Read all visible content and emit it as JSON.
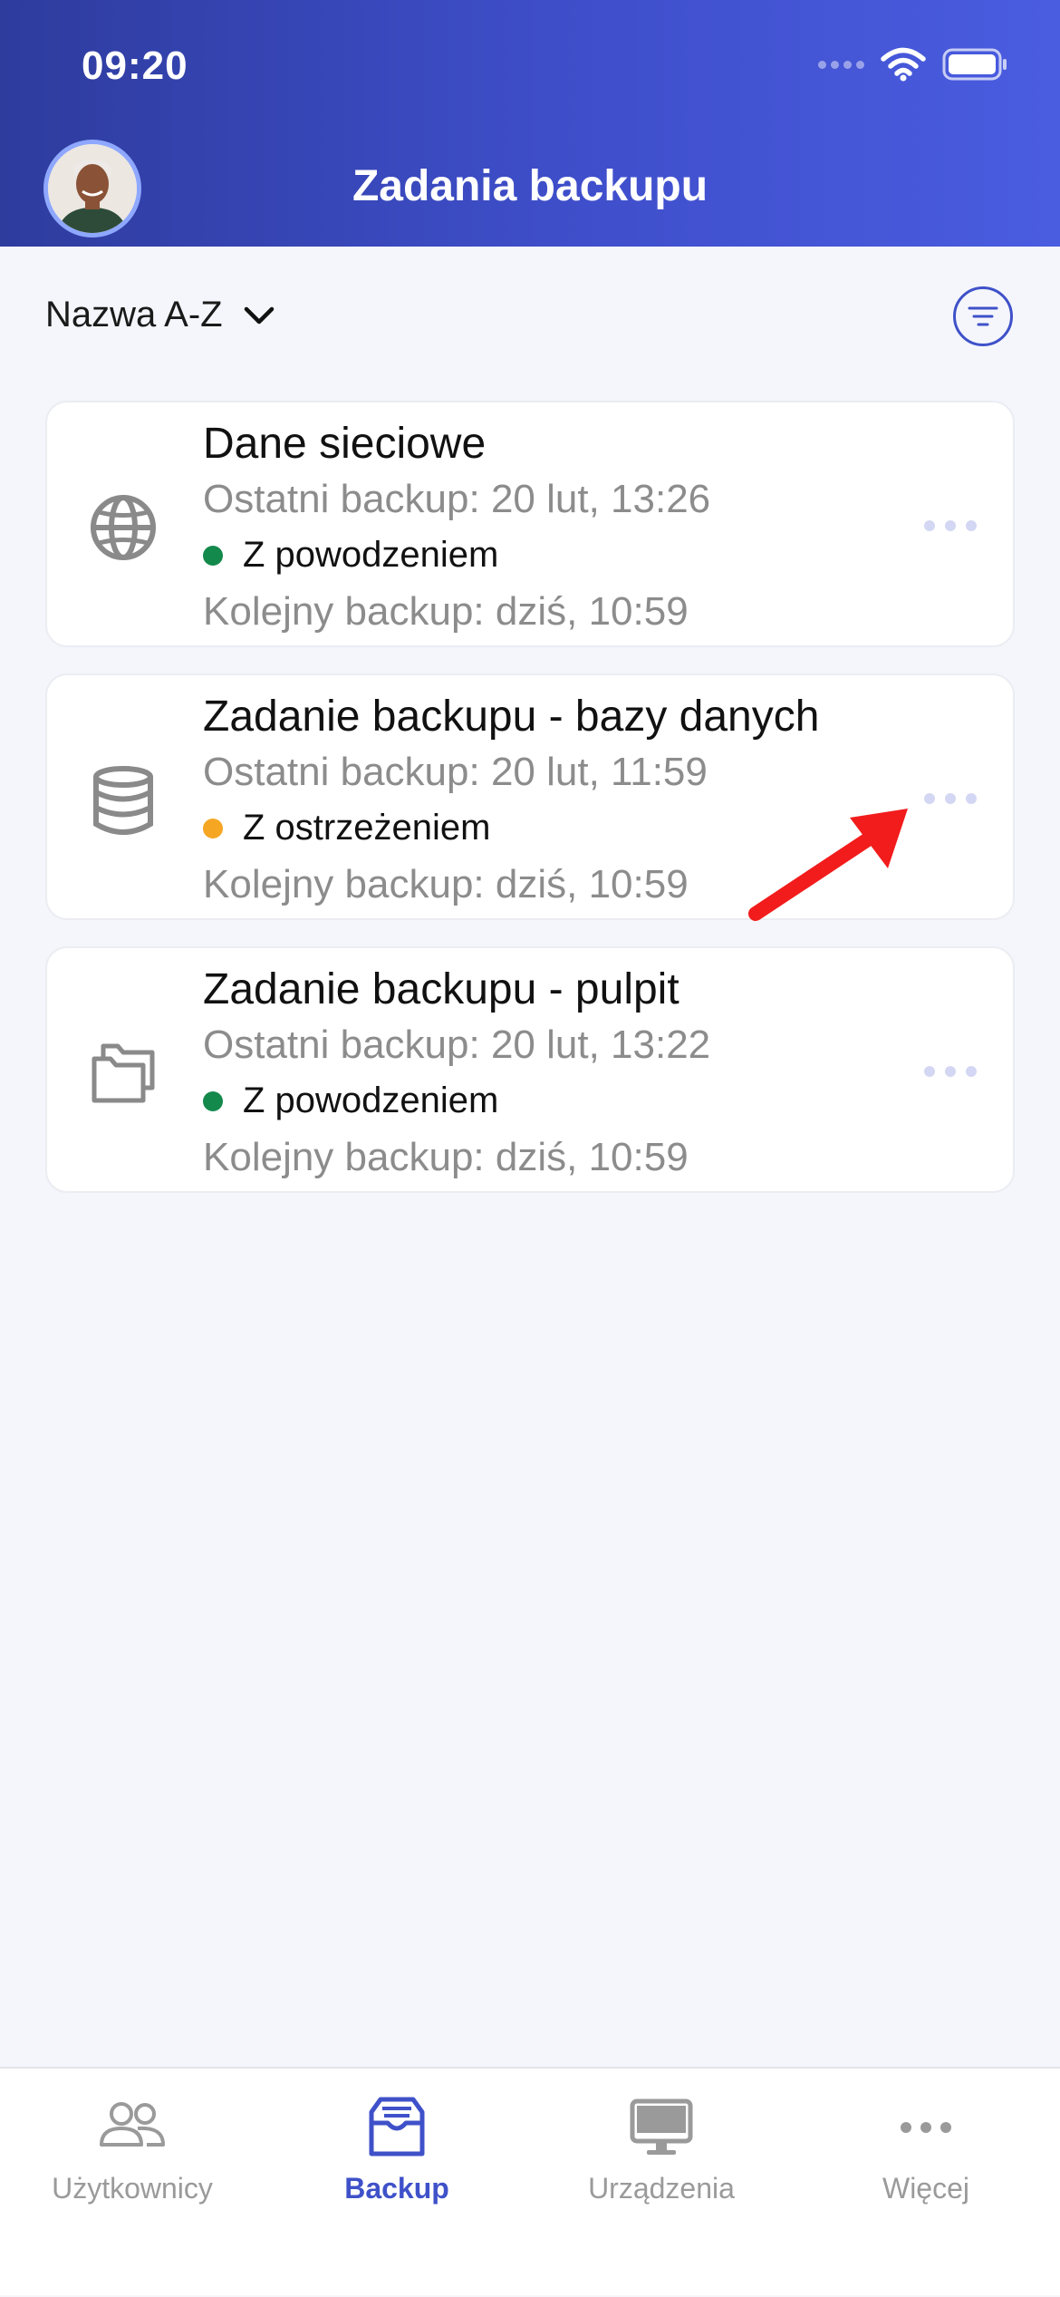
{
  "status_bar": {
    "time": "09:20"
  },
  "header": {
    "title": "Zadania backupu"
  },
  "sort": {
    "label": "Nazwa A-Z"
  },
  "colors": {
    "accent": "#3F51C9",
    "success": "#13894B",
    "warning": "#F5A623",
    "annotation_arrow": "#F21C1C"
  },
  "jobs": [
    {
      "icon": "globe-icon",
      "title": "Dane sieciowe",
      "last_backup": "Ostatni backup: 20 lut, 13:26",
      "status": "Z powodzeniem",
      "status_color": "#13894B",
      "next_backup": "Kolejny backup: dziś, 10:59"
    },
    {
      "icon": "database-icon",
      "title": "Zadanie backupu - bazy danych",
      "last_backup": "Ostatni backup: 20 lut, 11:59",
      "status": "Z ostrzeżeniem",
      "status_color": "#F5A623",
      "next_backup": "Kolejny backup: dziś, 10:59"
    },
    {
      "icon": "folders-icon",
      "title": "Zadanie backupu - pulpit",
      "last_backup": "Ostatni backup: 20 lut, 13:22",
      "status": "Z powodzeniem",
      "status_color": "#13894B",
      "next_backup": "Kolejny backup: dziś, 10:59"
    }
  ],
  "tabs": [
    {
      "label": "Użytkownicy",
      "icon": "users-icon",
      "active": false
    },
    {
      "label": "Backup",
      "icon": "backup-inbox-icon",
      "active": true
    },
    {
      "label": "Urządzenia",
      "icon": "monitor-icon",
      "active": false
    },
    {
      "label": "Więcej",
      "icon": "more-icon",
      "active": false
    }
  ]
}
